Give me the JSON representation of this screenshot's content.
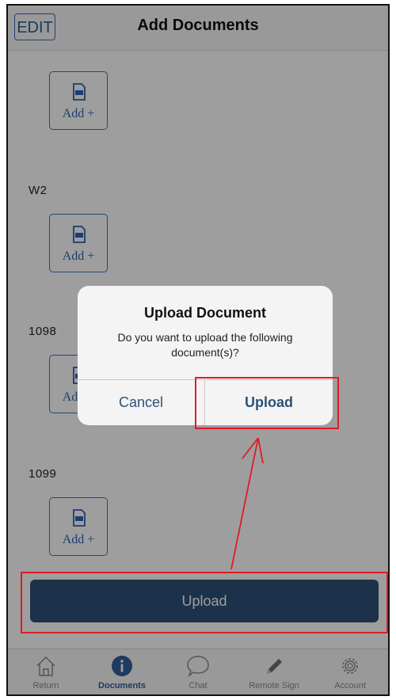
{
  "header": {
    "edit_label": "EDIT",
    "title": "Add Documents"
  },
  "sections": [
    {
      "label": "",
      "add_label": "Add +"
    },
    {
      "label": "W2",
      "add_label": "Add +"
    },
    {
      "label": "1098",
      "add_label": "Add +"
    },
    {
      "label": "1099",
      "add_label": "Add +"
    }
  ],
  "upload_button": {
    "label": "Upload"
  },
  "tabs": [
    {
      "label": "Return",
      "icon": "house-icon",
      "active": false
    },
    {
      "label": "Documents",
      "icon": "info-icon",
      "active": true
    },
    {
      "label": "Chat",
      "icon": "chat-bubble-icon",
      "active": false
    },
    {
      "label": "Remote Sign",
      "icon": "pencil-icon",
      "active": false
    },
    {
      "label": "Account",
      "icon": "gear-icon",
      "active": false
    }
  ],
  "dialog": {
    "title": "Upload Document",
    "message": "Do you want to upload the following document(s)?",
    "cancel_label": "Cancel",
    "confirm_label": "Upload"
  },
  "annotation": {
    "highlight_color": "#e01b24"
  },
  "colors": {
    "accent": "#2d5278",
    "link_blue": "#3b73c4"
  }
}
